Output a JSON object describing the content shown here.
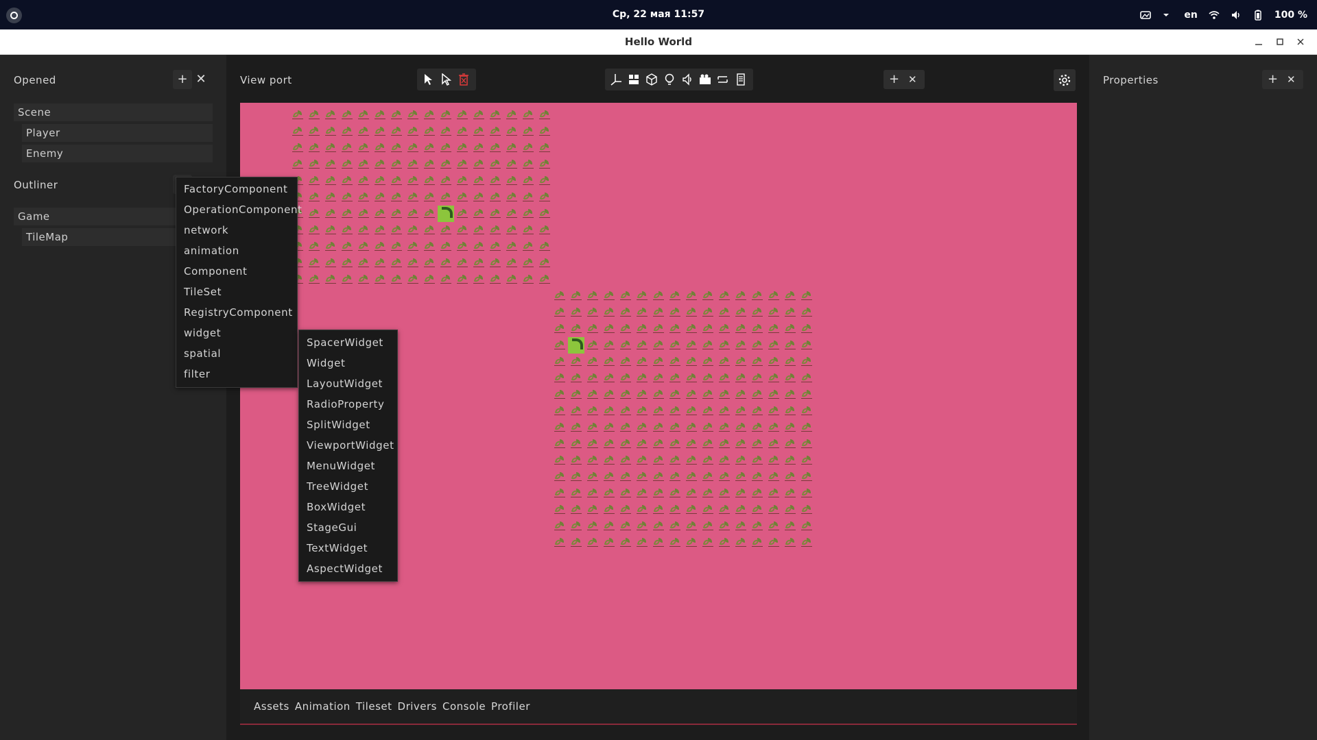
{
  "topbar": {
    "clock": "Ср, 22 мая  11:57",
    "language": "en",
    "battery": "100 %"
  },
  "window": {
    "title": "Hello World"
  },
  "left_panel": {
    "opened_label": "Opened",
    "opened_items": [
      "Scene",
      "Player",
      "Enemy"
    ],
    "outliner_label": "Outliner",
    "outliner_items": [
      "Game",
      "TileMap"
    ]
  },
  "center_panel": {
    "viewport_label": "View port",
    "bottom_tabs": [
      "Assets",
      "Animation",
      "Tileset",
      "Drivers",
      "Console",
      "Profiler"
    ]
  },
  "right_panel": {
    "properties_label": "Properties"
  },
  "context_menu": {
    "items": [
      "FactoryComponent",
      "OperationComponent",
      "network",
      "animation",
      "Component",
      "TileSet",
      "RegistryComponent",
      "widget",
      "spatial",
      "filter"
    ]
  },
  "submenu": {
    "items": [
      "SpacerWidget",
      "Widget",
      "LayoutWidget",
      "RadioProperty",
      "SplitWidget",
      "ViewportWidget",
      "MenuWidget",
      "TreeWidget",
      "BoxWidget",
      "StageGui",
      "TextWidget",
      "AspectWidget"
    ]
  },
  "icons": {
    "viewport_tools": [
      "select-arrow-icon",
      "select-arrow-outline-icon",
      "delete-icon"
    ],
    "node_tools": [
      "axis-icon",
      "widgets-icon",
      "cube-icon",
      "light-bulb-icon",
      "speaker-icon",
      "camera-icon",
      "swap-icon",
      "document-icon"
    ]
  },
  "colors": {
    "viewport_bg": "#dc5a84",
    "delete_icon": "#e03a3a",
    "cursor_tile": "#8cc53c"
  }
}
